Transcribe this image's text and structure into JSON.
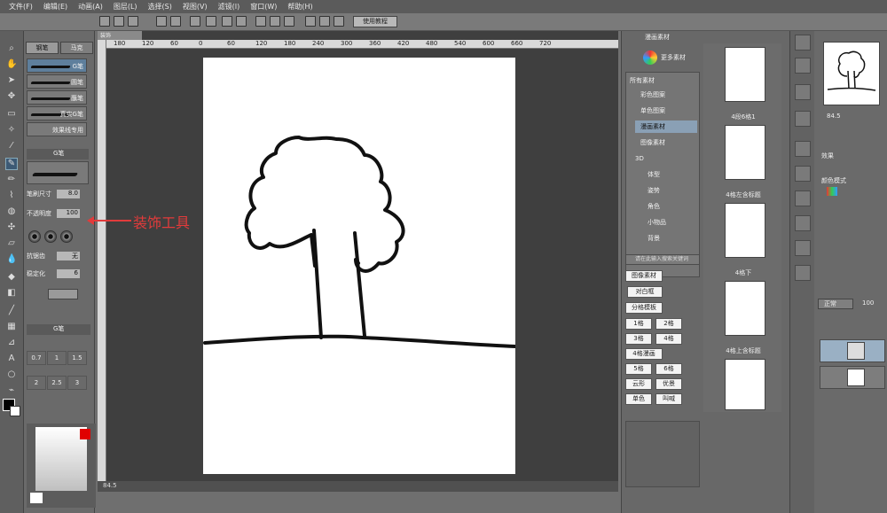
{
  "menubar": {
    "items": [
      "文件(F)",
      "编辑(E)",
      "动画(A)",
      "图层(L)",
      "选择(S)",
      "视图(V)",
      "滤镜(I)",
      "窗口(W)",
      "帮助(H)"
    ]
  },
  "command_bar": {
    "tutorial_button": "使用教程"
  },
  "document": {
    "tab_label": "装饰",
    "ruler_ticks": [
      "180",
      "120",
      "60",
      "0",
      "60",
      "120",
      "180",
      "240",
      "300",
      "360",
      "420",
      "480",
      "540",
      "600",
      "660",
      "720"
    ],
    "zoom": "84.5"
  },
  "subtool": {
    "tabs": [
      "钢笔",
      "马克"
    ],
    "brushes": [
      "G笔",
      "圆笔",
      "蘸笔",
      "真实G笔",
      "效果线专用"
    ],
    "tool_label": "G笔",
    "prop_labels": [
      "笔刷尺寸",
      "不透明度",
      "抗锯齿",
      "稳定化"
    ],
    "size_value": "8.0",
    "opacity_value": "100",
    "stabilizer_value": "6",
    "none_label": "无",
    "size_grid": [
      "0.7",
      "1",
      "1.5",
      "2",
      "2.5",
      "3"
    ]
  },
  "annotation": {
    "label": "装饰工具",
    "color": "#e23b3b"
  },
  "materials": {
    "panel_tab": "漫画素材",
    "more_button": "更多素材",
    "tree": [
      "所有素材",
      "彩色图案",
      "单色图案",
      "漫画素材",
      "图像素材",
      "3D",
      "体型",
      "姿势",
      "角色",
      "小物品",
      "背景"
    ],
    "selected_tree_index": 3,
    "thumb_labels": [
      "4段6格1",
      "4格左含标题",
      "4格下",
      "4格上含标题"
    ],
    "search_placeholder": "请在此输入搜索关键词",
    "tags": [
      "图像素材",
      "对白框",
      "分格模板",
      "1格",
      "2格",
      "3格",
      "4格",
      "4格漫画",
      "5格",
      "6格",
      "云形",
      "优景",
      "单色",
      "叫喊"
    ]
  },
  "navigator": {
    "zoom": "84.5",
    "effect_label": "效果",
    "color_mode_label": "颜色模式"
  },
  "layers": {
    "blend_mode": "正常",
    "opacity": "100"
  },
  "colors": {
    "accent": "#e23b3b",
    "selection": "#5e7f9c"
  }
}
